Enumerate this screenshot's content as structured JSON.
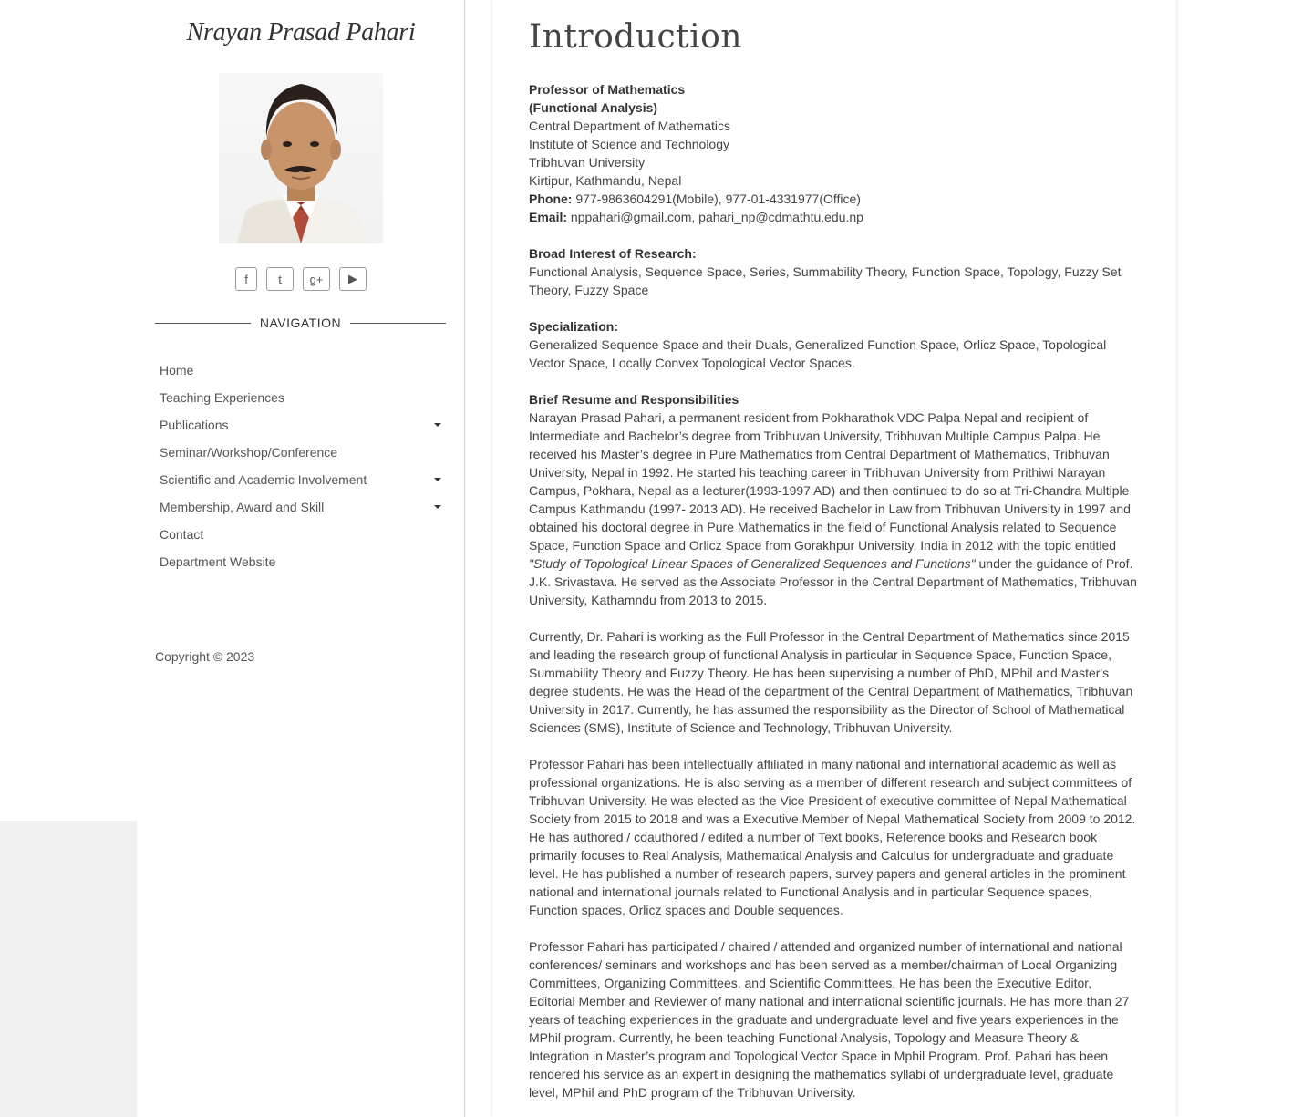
{
  "sidebar": {
    "site_title": "Nrayan Prasad Pahari",
    "social": [
      {
        "icon": "facebook-icon",
        "glyph": "f"
      },
      {
        "icon": "twitter-icon",
        "glyph": "t"
      },
      {
        "icon": "google-plus-icon",
        "glyph": "g+"
      },
      {
        "icon": "youtube-icon",
        "glyph": "▶"
      }
    ],
    "nav_heading": "NAVIGATION",
    "nav_items": [
      {
        "label": "Home",
        "has_submenu": false
      },
      {
        "label": "Teaching Experiences",
        "has_submenu": false
      },
      {
        "label": "Publications",
        "has_submenu": true
      },
      {
        "label": "Seminar/Workshop/Conference",
        "has_submenu": false
      },
      {
        "label": "Scientific and Academic Involvement",
        "has_submenu": true
      },
      {
        "label": "Membership, Award and Skill",
        "has_submenu": true
      },
      {
        "label": "Contact",
        "has_submenu": false
      },
      {
        "label": "Department Website",
        "has_submenu": false
      }
    ],
    "copyright": "Copyright © 2023"
  },
  "main": {
    "title": "Introduction",
    "position_line1": "Professor of Mathematics",
    "position_line2": "(Functional Analysis)",
    "address": [
      "Central Department of Mathematics",
      "Institute of Science and Technology",
      "Tribhuvan University",
      "Kirtipur, Kathmandu, Nepal"
    ],
    "phone_label": "Phone:",
    "phone_value": " 977-9863604291(Mobile), 977-01-4331977(Office)",
    "email_label": "Email:",
    "email_value": " nppahari@gmail.com, pahari_np@cdmathtu.edu.np",
    "research_heading": "Broad Interest of Research:",
    "research_text": "Functional Analysis, Sequence Space, Series, Summability Theory, Function Space, Topology, Fuzzy Set Theory, Fuzzy Space",
    "specialization_heading": "Specialization:",
    "specialization_text": "Generalized Sequence Space and their Duals, Generalized Function Space, Orlicz Space, Topological Vector Space, Locally Convex Topological Vector Spaces.",
    "resume_heading": "Brief Resume and Responsibilities",
    "resume_p1_before": "Narayan Prasad Pahari, a permanent resident from Pokharathok VDC Palpa Nepal and recipient of Intermediate and Bachelor’s degree from Tribhuvan University, Tribhuvan Multiple Campus Palpa. He received his Master’s degree in Pure Mathematics from Central Department of Mathematics, Tribhuvan University, Nepal in 1992. He started his teaching career in Tribhuvan University from Prithiwi Narayan Campus, Pokhara, Nepal as a lecturer(1993-1997 AD) and then continued to do so at Tri-Chandra Multiple Campus Kathmandu (1997- 2013 AD). He received Bachelor in Law from Tribhuvan University in 1997 and obtained his doctoral degree in Pure Mathematics in the field of Functional Analysis related to Sequence Space, Function Space and Orlicz Space from Gorakhpur University, India in 2012 with the topic entitled ",
    "resume_p1_thesis": "\"Study of Topological Linear Spaces of Generalized Sequences and Functions\"",
    "resume_p1_after": " under the guidance of Prof. J.K. Srivastava. He served as the Associate Professor in the Central Department of Mathematics, Tribhuvan University, Kathamndu from 2013 to 2015.",
    "resume_p2": "Currently, Dr. Pahari is working as the Full Professor in the Central Department of Mathematics since 2015 and leading the research group of functional Analysis in particular in Sequence Space, Function Space, Summability Theory and Fuzzy Theory. He has been supervising a number of PhD, MPhil and Master's degree students. He was the Head of the department of the Central Department of Mathematics, Tribhuvan University in 2017. Currently, he has assumed the responsibility as the Director of School of Mathematical Sciences (SMS), Institute of Science and Technology, Tribhuvan University.",
    "resume_p3": "Professor Pahari has been intellectually affiliated in many national and international academic as well as professional organizations. He is also serving as a member of different research and subject committees of Tribhuvan University. He was elected as the Vice President of executive committee of Nepal Mathematical Society from 2015 to 2018 and was a Executive Member of Nepal Mathematical Society from 2009 to 2012. He has authored / coauthored / edited a number of Text books, Reference books and Research book primarily focuses to Real Analysis, Mathematical Analysis and Calculus for undergraduate and graduate level. He has published a number of research papers, survey papers and general articles in the prominent national and international journals related to Functional Analysis and in particular Sequence spaces, Function spaces, Orlicz spaces and Double sequences.",
    "resume_p4": "Professor Pahari has participated / chaired / attended and organized number of international and national conferences/ seminars and workshops and has been served as a member/chairman of Local Organizing Committees, Organizing Committees, and Scientific Committees. He has been the Executive Editor, Editorial Member and Reviewer of many national and international scientific journals. He has more than 27 years of teaching experiences in the graduate and undergraduate level and five years experiences in the MPhil program. Currently, he been teaching Functional Analysis, Topology and Measure Theory & Integration in Master’s program and Topological Vector Space in Mphil Program. Prof. Pahari has been rendered his service as an expert in designing the mathematics syllabi of undergraduate level, graduate level, MPhil and PhD program of the Tribhuvan University."
  }
}
